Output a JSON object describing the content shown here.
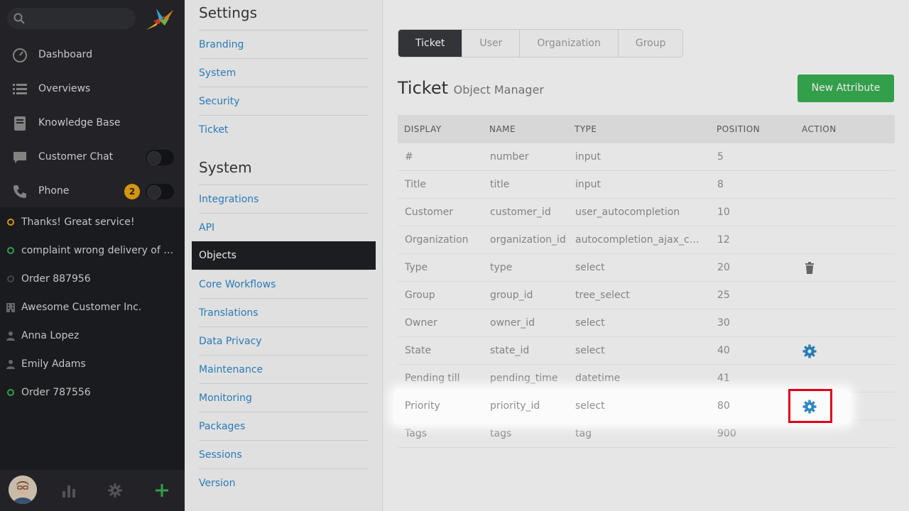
{
  "nav": {
    "items": [
      {
        "label": "Dashboard",
        "icon": "dashboard-icon"
      },
      {
        "label": "Overviews",
        "icon": "list-icon"
      },
      {
        "label": "Knowledge Base",
        "icon": "book-icon"
      },
      {
        "label": "Customer Chat",
        "icon": "chat-icon"
      },
      {
        "label": "Phone",
        "icon": "phone-icon",
        "badge": "2"
      }
    ],
    "tasks": [
      {
        "label": "Thanks! Great service!",
        "icon": "ticket-pending-icon"
      },
      {
        "label": "complaint wrong delivery of ord...",
        "icon": "ticket-open-icon"
      },
      {
        "label": "Order 887956",
        "icon": "ticket-closed-icon"
      },
      {
        "label": "Awesome Customer Inc.",
        "icon": "building-icon"
      },
      {
        "label": "Anna Lopez",
        "icon": "user-icon"
      },
      {
        "label": "Emily Adams",
        "icon": "user-icon"
      },
      {
        "label": "Order 787556",
        "icon": "ticket-open-icon"
      }
    ]
  },
  "settings": {
    "title": "Settings",
    "items": [
      "Branding",
      "System",
      "Security",
      "Ticket"
    ],
    "system_title": "System",
    "system_items": [
      "Integrations",
      "API",
      "Objects",
      "Core Workflows",
      "Translations",
      "Data Privacy",
      "Maintenance",
      "Monitoring",
      "Packages",
      "Sessions",
      "Version"
    ]
  },
  "main": {
    "tabs": [
      "Ticket",
      "User",
      "Organization",
      "Group"
    ],
    "title": "Ticket",
    "subtitle": "Object Manager",
    "new_button": "New Attribute",
    "columns": [
      "DISPLAY",
      "NAME",
      "TYPE",
      "POSITION",
      "ACTION"
    ],
    "rows": [
      {
        "display": "#",
        "name": "number",
        "type": "input",
        "position": "5",
        "action": ""
      },
      {
        "display": "Title",
        "name": "title",
        "type": "input",
        "position": "8",
        "action": ""
      },
      {
        "display": "Customer",
        "name": "customer_id",
        "type": "user_autocompletion",
        "position": "10",
        "action": ""
      },
      {
        "display": "Organization",
        "name": "organization_id",
        "type": "autocompletion_ajax_cust...",
        "position": "12",
        "action": ""
      },
      {
        "display": "Type",
        "name": "type",
        "type": "select",
        "position": "20",
        "action": "trash-icon"
      },
      {
        "display": "Group",
        "name": "group_id",
        "type": "tree_select",
        "position": "25",
        "action": ""
      },
      {
        "display": "Owner",
        "name": "owner_id",
        "type": "select",
        "position": "30",
        "action": ""
      },
      {
        "display": "State",
        "name": "state_id",
        "type": "select",
        "position": "40",
        "action": "gear-icon"
      },
      {
        "display": "Pending till",
        "name": "pending_time",
        "type": "datetime",
        "position": "41",
        "action": ""
      },
      {
        "display": "Priority",
        "name": "priority_id",
        "type": "select",
        "position": "80",
        "action": "gear-icon"
      },
      {
        "display": "Tags",
        "name": "tags",
        "type": "tag",
        "position": "900",
        "action": ""
      }
    ]
  },
  "colors": {
    "accent": "#2e86c6",
    "success": "#38ad52",
    "highlight": "#e0001a"
  }
}
